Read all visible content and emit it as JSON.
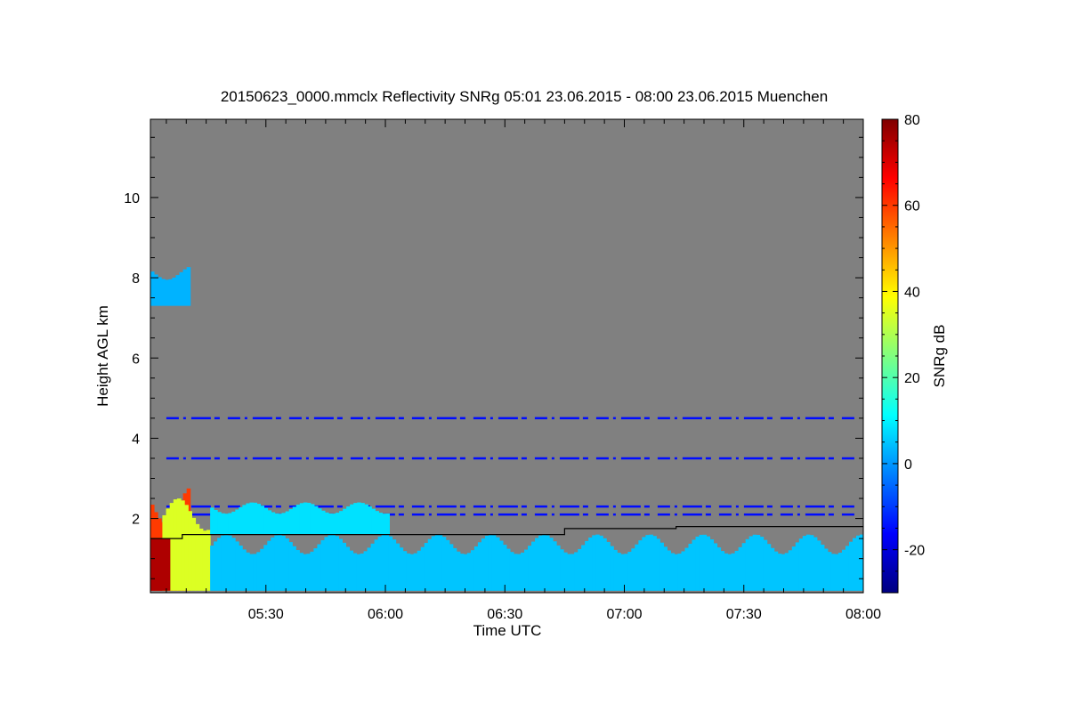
{
  "chart_data": {
    "type": "heatmap",
    "title": "20150623_0000.mmclx Reflectivity SNRg   05:01 23.06.2015 - 08:00 23.06.2015 Muenchen",
    "xlabel": "Time UTC",
    "ylabel": "Height AGL km",
    "colorbar_label": "SNRg dB",
    "x_range": [
      "05:01",
      "08:00"
    ],
    "x_ticks": [
      "05:30",
      "06:00",
      "06:30",
      "07:00",
      "07:30",
      "08:00"
    ],
    "x_tick_minutes": [
      29,
      59,
      89,
      119,
      149,
      179
    ],
    "y_range": [
      0.15,
      11.95
    ],
    "y_ticks": [
      2,
      4,
      6,
      8,
      10
    ],
    "colorbar_range": [
      -30,
      80
    ],
    "colorbar_ticks": [
      -20,
      0,
      20,
      40,
      60,
      80
    ],
    "background_color": "#808080",
    "colormap": [
      "#00007f",
      "#0000ff",
      "#0080ff",
      "#00ffff",
      "#80ff80",
      "#ffff00",
      "#ff8000",
      "#ff0000",
      "#7f0000"
    ],
    "features": [
      {
        "t0": 0,
        "t1": 10,
        "h0": 0.2,
        "h1": 2.8,
        "snr": 60
      },
      {
        "t0": 3,
        "t1": 15,
        "h0": 0.2,
        "h1": 2.5,
        "snr": 35
      },
      {
        "t0": 15,
        "t1": 60,
        "h0": 1.6,
        "h1": 2.4,
        "snr": 8
      },
      {
        "t0": 15,
        "t1": 179,
        "h0": 0.2,
        "h1": 1.6,
        "snr": 5
      },
      {
        "t0": 0,
        "t1": 10,
        "h0": 7.3,
        "h1": 8.3,
        "snr": 3
      }
    ],
    "lines": [
      {
        "h": 4.5,
        "snr": -15
      },
      {
        "h": 3.5,
        "snr": -15
      },
      {
        "h": 2.3,
        "snr": -15
      },
      {
        "h": 2.1,
        "snr": -15
      }
    ],
    "boundary_layer_steps": [
      {
        "t": 0,
        "h": 1.5
      },
      {
        "t": 8,
        "h": 1.6
      },
      {
        "t": 104,
        "h": 1.75
      },
      {
        "t": 132,
        "h": 1.8
      },
      {
        "t": 179,
        "h": 1.8
      }
    ]
  }
}
